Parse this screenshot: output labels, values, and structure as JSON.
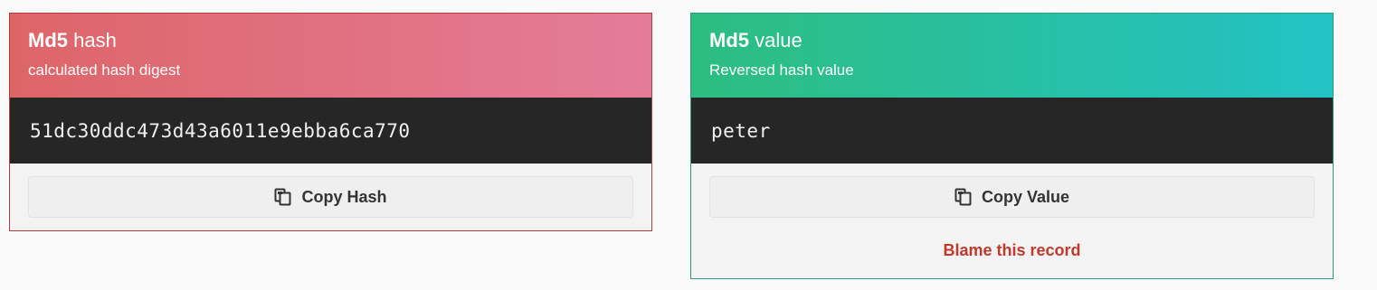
{
  "hash_card": {
    "algorithm": "Md5",
    "kind": "hash",
    "subtitle": "calculated hash digest",
    "digest": "51dc30ddc473d43a6011e9ebba6ca770",
    "copy_label": "Copy Hash",
    "copy_icon": "clipboard-copy-icon",
    "header_gradient": [
      "#dd6568",
      "#e47c99"
    ],
    "border_color": "#b83a3a"
  },
  "value_card": {
    "algorithm": "Md5",
    "kind": "value",
    "subtitle": "Reversed hash value",
    "value": "peter",
    "copy_label": "Copy Value",
    "copy_icon": "clipboard-copy-icon",
    "blame_label": "Blame this record",
    "header_gradient": [
      "#2dbd80",
      "#23c2c5"
    ],
    "border_color": "#2a9d7a",
    "blame_color": "#c0392b"
  }
}
